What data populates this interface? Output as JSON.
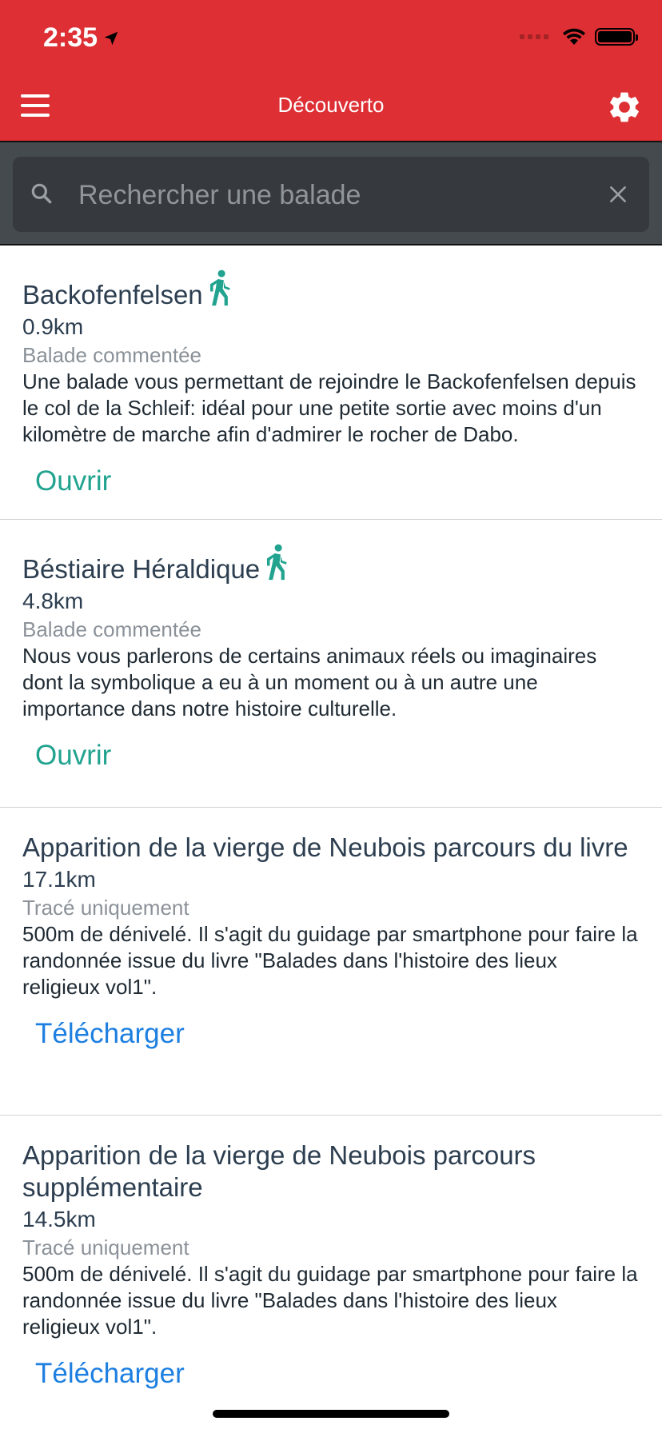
{
  "status": {
    "time": "2:35"
  },
  "navbar": {
    "title": "Découverto"
  },
  "search": {
    "placeholder": "Rechercher une balade"
  },
  "colors": {
    "header": "#dd2f34",
    "search_bg": "#454a4f",
    "open_action": "#21a38f",
    "download_action": "#1d7fe0"
  },
  "items": [
    {
      "title": "Backofenfelsen",
      "walk_icon": true,
      "distance": "0.9km",
      "type": "Balade commentée",
      "description": "Une balade vous permettant de rejoindre le Backofenfelsen depuis le col de la Schleif: idéal pour une petite sortie avec moins d'un kilomètre de marche afin d'admirer le rocher de Dabo.",
      "action": "Ouvrir"
    },
    {
      "title": "Béstiaire Héraldique",
      "walk_icon": true,
      "distance": "4.8km",
      "type": "Balade commentée",
      "description": "Nous vous parlerons de certains animaux réels ou imaginaires dont la symbolique a eu à un moment ou à un autre une importance dans notre histoire culturelle.",
      "action": "Ouvrir"
    },
    {
      "title": "Apparition de la vierge de Neubois parcours du livre",
      "walk_icon": false,
      "distance": "17.1km",
      "type": "Tracé uniquement",
      "description": "500m de dénivelé. Il s'agit du guidage par smartphone pour faire la randonnée issue du livre \"Balades dans l'histoire des lieux religieux vol1\".",
      "action": "Télécharger"
    },
    {
      "title": "Apparition de la vierge de Neubois parcours supplémentaire",
      "walk_icon": false,
      "distance": "14.5km",
      "type": "Tracé uniquement",
      "description": "500m de dénivelé. Il s'agit du guidage par smartphone pour faire la randonnée issue du livre \"Balades dans l'histoire des lieux religieux vol1\".",
      "action": "Télécharger"
    }
  ]
}
